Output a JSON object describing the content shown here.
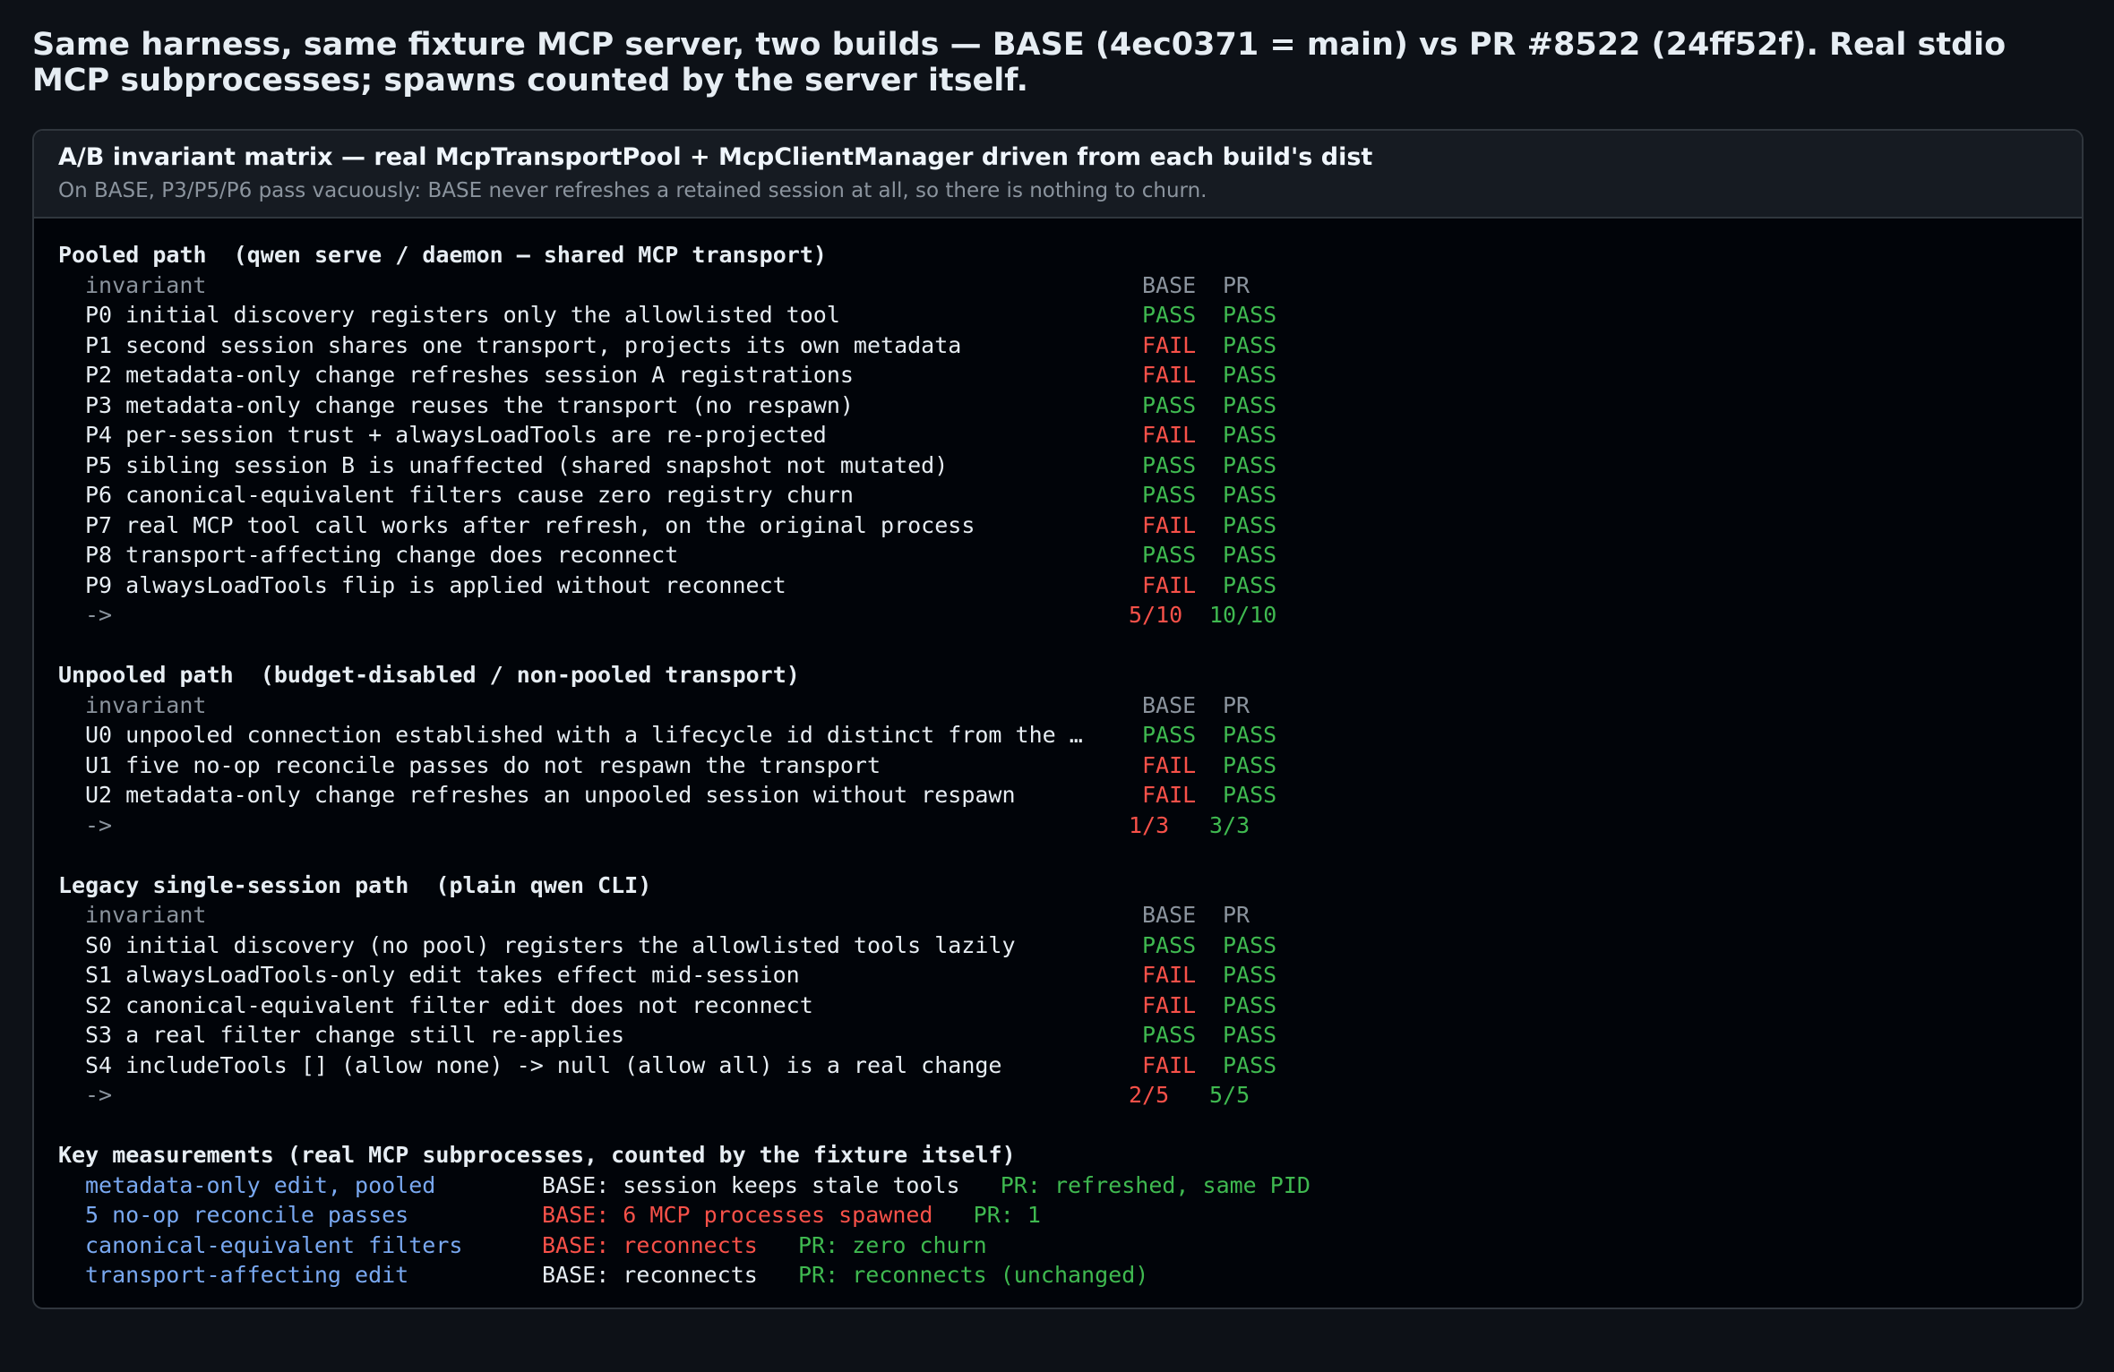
{
  "headline": "Same harness, same fixture MCP server, two builds — BASE (4ec0371 = main) vs PR #8522 (24ff52f). Real stdio MCP subprocesses; spawns counted by the server itself.",
  "panel": {
    "title": "A/B invariant matrix — real McpTransportPool + McpClientManager driven from each build's dist",
    "subtitle": "On BASE, P3/P5/P6 pass vacuously: BASE never refreshes a retained session at all, so there is nothing to churn."
  },
  "columns": {
    "invariant": "invariant",
    "base": "BASE",
    "pr": "PR"
  },
  "arrow": "->",
  "colors": {
    "pass": "#3fb950",
    "fail": "#f85149",
    "accent": "#79a8f0",
    "background": "#010409"
  },
  "sections": [
    {
      "title": "Pooled path  (qwen serve / daemon — shared MCP transport)",
      "rows": [
        {
          "text": "P0 initial discovery registers only the allowlisted tool",
          "base": "PASS",
          "pr": "PASS"
        },
        {
          "text": "P1 second session shares one transport, projects its own metadata",
          "base": "FAIL",
          "pr": "PASS"
        },
        {
          "text": "P2 metadata-only change refreshes session A registrations",
          "base": "FAIL",
          "pr": "PASS"
        },
        {
          "text": "P3 metadata-only change reuses the transport (no respawn)",
          "base": "PASS",
          "pr": "PASS"
        },
        {
          "text": "P4 per-session trust + alwaysLoadTools are re-projected",
          "base": "FAIL",
          "pr": "PASS"
        },
        {
          "text": "P5 sibling session B is unaffected (shared snapshot not mutated)",
          "base": "PASS",
          "pr": "PASS"
        },
        {
          "text": "P6 canonical-equivalent filters cause zero registry churn",
          "base": "PASS",
          "pr": "PASS"
        },
        {
          "text": "P7 real MCP tool call works after refresh, on the original process",
          "base": "FAIL",
          "pr": "PASS"
        },
        {
          "text": "P8 transport-affecting change does reconnect",
          "base": "PASS",
          "pr": "PASS"
        },
        {
          "text": "P9 alwaysLoadTools flip is applied without reconnect",
          "base": "FAIL",
          "pr": "PASS"
        }
      ],
      "score_base": "5/10",
      "score_pr": "10/10"
    },
    {
      "title": "Unpooled path  (budget-disabled / non-pooled transport)",
      "rows": [
        {
          "text": "U0 unpooled connection established with a lifecycle id distinct from the …",
          "base": "PASS",
          "pr": "PASS"
        },
        {
          "text": "U1 five no-op reconcile passes do not respawn the transport",
          "base": "FAIL",
          "pr": "PASS"
        },
        {
          "text": "U2 metadata-only change refreshes an unpooled session without respawn",
          "base": "FAIL",
          "pr": "PASS"
        }
      ],
      "score_base": "1/3",
      "score_pr": "3/3"
    },
    {
      "title": "Legacy single-session path  (plain qwen CLI)",
      "rows": [
        {
          "text": "S0 initial discovery (no pool) registers the allowlisted tools lazily",
          "base": "PASS",
          "pr": "PASS"
        },
        {
          "text": "S1 alwaysLoadTools-only edit takes effect mid-session",
          "base": "FAIL",
          "pr": "PASS"
        },
        {
          "text": "S2 canonical-equivalent filter edit does not reconnect",
          "base": "FAIL",
          "pr": "PASS"
        },
        {
          "text": "S3 a real filter change still re-applies",
          "base": "PASS",
          "pr": "PASS"
        },
        {
          "text": "S4 includeTools [] (allow none) -> null (allow all) is a real change",
          "base": "FAIL",
          "pr": "PASS"
        }
      ],
      "score_base": "2/5",
      "score_pr": "5/5"
    }
  ],
  "measurements": {
    "title": "Key measurements (real MCP subprocesses, counted by the fixture itself)",
    "rows": [
      {
        "label": "metadata-only edit, pooled",
        "base": "BASE: session keeps stale tools",
        "base_status": "neutral",
        "pr": "PR: refreshed, same PID"
      },
      {
        "label": "5 no-op reconcile passes",
        "base": "BASE: 6 MCP processes spawned",
        "base_status": "fail",
        "pr": "PR: 1"
      },
      {
        "label": "canonical-equivalent filters",
        "base": "BASE: reconnects",
        "base_status": "fail",
        "pr": "PR: zero churn"
      },
      {
        "label": "transport-affecting edit",
        "base": "BASE: reconnects",
        "base_status": "neutral",
        "pr": "PR: reconnects (unchanged)"
      }
    ]
  }
}
